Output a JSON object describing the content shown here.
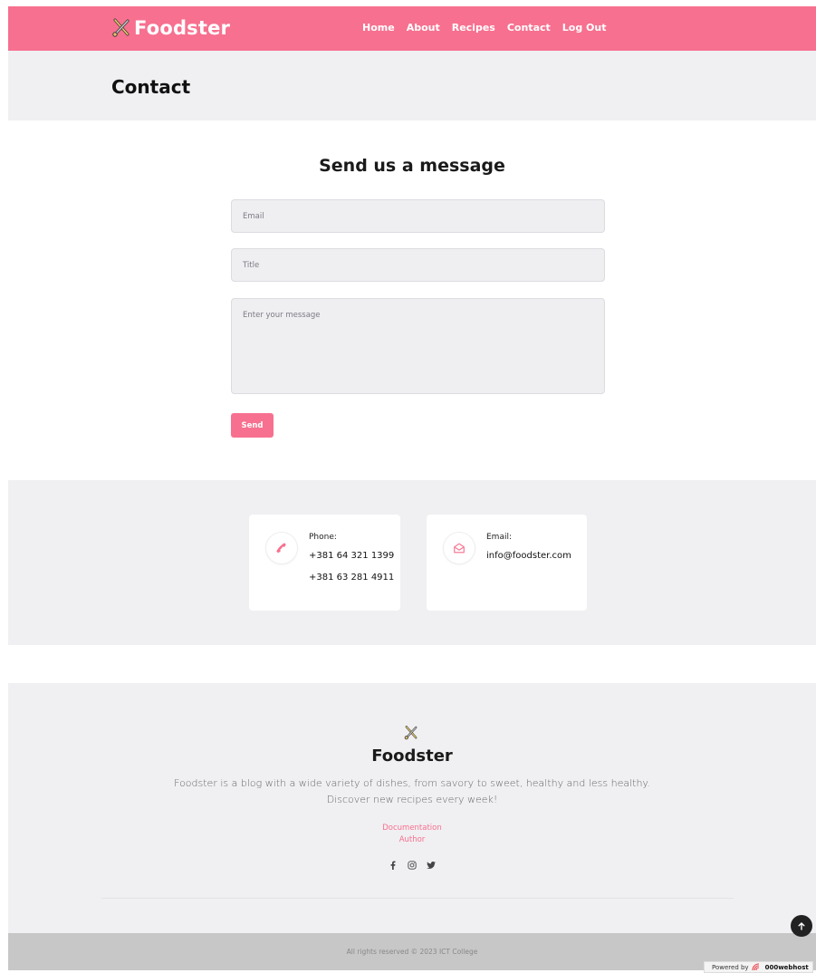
{
  "header": {
    "brand": "Foodster",
    "nav": [
      "Home",
      "About",
      "Recipes",
      "Contact",
      "Log Out"
    ]
  },
  "page": {
    "title": "Contact"
  },
  "form": {
    "heading": "Send us a message",
    "email_placeholder": "Email",
    "title_placeholder": "Title",
    "message_placeholder": "Enter your message",
    "send_label": "Send"
  },
  "contact": {
    "phone_label": "Phone:",
    "phones": [
      "+381 64 321 1399",
      "+381 63 281 4911"
    ],
    "email_label": "Email:",
    "email": "info@foodster.com"
  },
  "footer": {
    "brand": "Foodster",
    "description": "Foodster is a blog with a wide variety of dishes, from savory to sweet, healthy and less healthy. Discover new recipes every week!",
    "links": [
      "Documentation",
      "Author"
    ],
    "socials": [
      "facebook-icon",
      "instagram-icon",
      "twitter-icon"
    ],
    "copyright": "All rights reserved © 2023 ICT College"
  },
  "badge": {
    "prefix": "Powered by",
    "name": "000webhost"
  },
  "colors": {
    "accent": "#f7708f",
    "band": "#f0eff2",
    "bottom": "#c7c7c7"
  }
}
